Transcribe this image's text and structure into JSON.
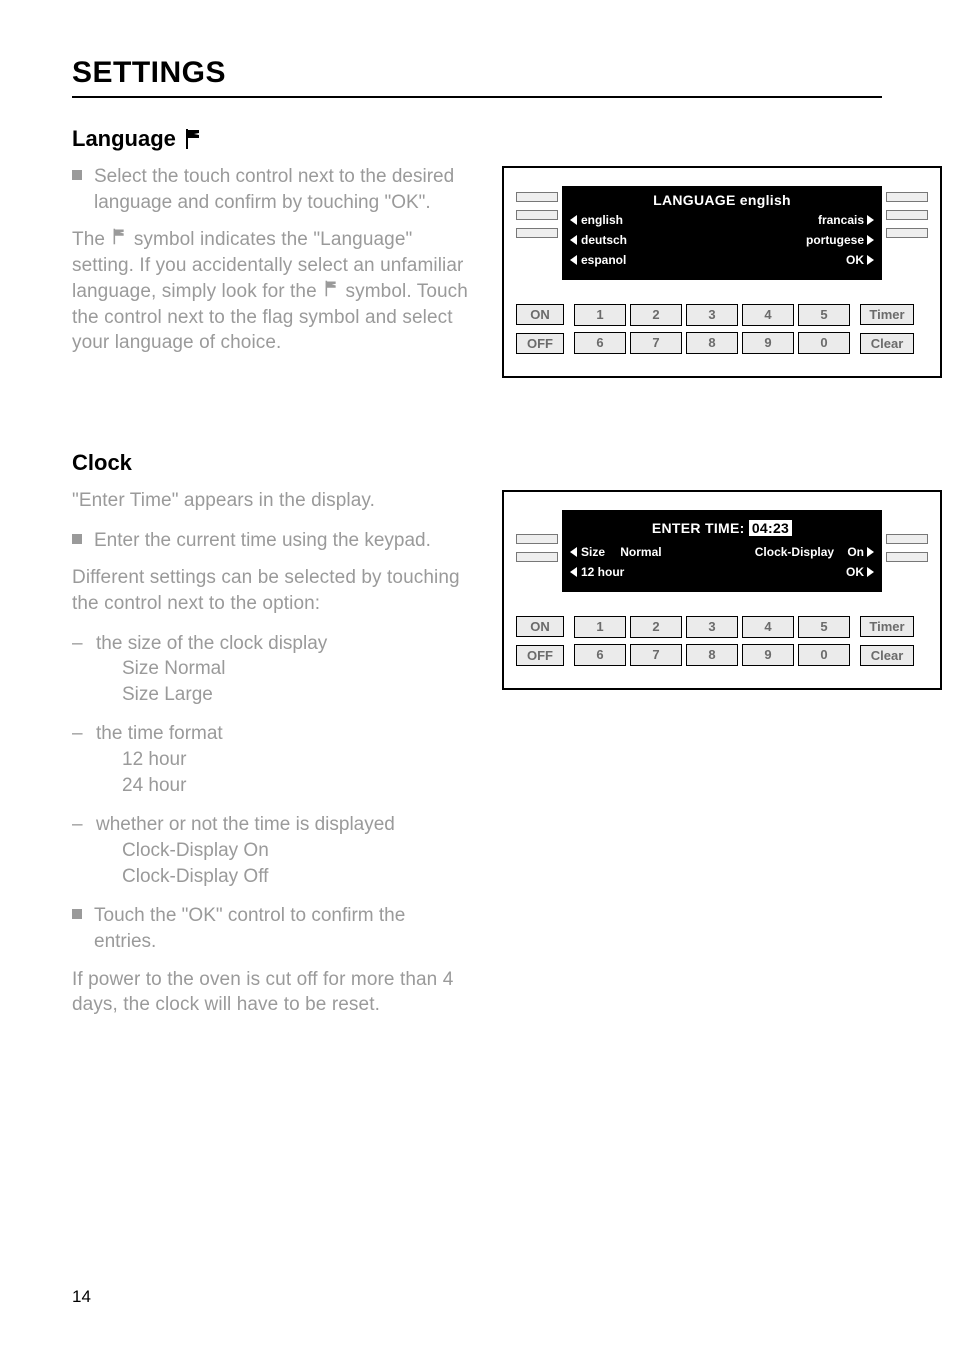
{
  "pageNumber": "14",
  "pageTitle": "SETTINGS",
  "language": {
    "heading": "Language",
    "bullet1": "Select the touch control next to the desired language and confirm by touching \"OK\".",
    "para1_pre": "The ",
    "para1_mid": " symbol indicates the \"Language\" setting. If you accidentally select an unfamiliar language, simply look for the ",
    "para1_post": " symbol. Touch the control next to the flag symbol and select your language of choice.",
    "panel": {
      "title": "LANGUAGE english",
      "left": [
        "english",
        "deutsch",
        "espanol"
      ],
      "right": [
        "francais",
        "portugese",
        "OK"
      ],
      "on": "ON",
      "off": "OFF",
      "nums": [
        "1",
        "2",
        "3",
        "4",
        "5",
        "6",
        "7",
        "8",
        "9",
        "0"
      ],
      "timer": "Timer",
      "clear": "Clear"
    }
  },
  "clock": {
    "heading": "Clock",
    "intro": " \"Enter Time\" appears in the display.",
    "bullet1": "Enter the current time using the keypad.",
    "para1": "Different settings can be selected by touching the control next to the option:",
    "opt1": {
      "head": "the size of the clock display",
      "a": "Size Normal",
      "b": "Size Large"
    },
    "opt2": {
      "head": "the time format",
      "a": "12 hour",
      "b": "24 hour"
    },
    "opt3": {
      "head": "whether or not the time is displayed",
      "a": "Clock-Display On",
      "b": "Clock-Display Off"
    },
    "bullet2": "Touch the \"OK\" control to confirm the entries.",
    "para2": "If power to the oven is cut off for more than 4 days, the clock will have to be reset.",
    "panel": {
      "titlePre": "ENTER TIME: ",
      "titleHl": "04:23",
      "leftRow2": {
        "a": "Size",
        "b": "Normal"
      },
      "rightRow2": {
        "a": "Clock-Display",
        "b": "On"
      },
      "leftRow3": "12 hour",
      "rightRow3": "OK",
      "on": "ON",
      "off": "OFF",
      "nums": [
        "1",
        "2",
        "3",
        "4",
        "5",
        "6",
        "7",
        "8",
        "9",
        "0"
      ],
      "timer": "Timer",
      "clear": "Clear"
    }
  }
}
